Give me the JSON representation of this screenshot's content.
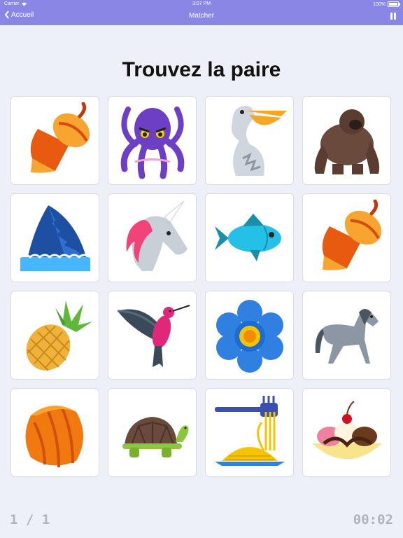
{
  "status_bar": {
    "carrier": "Carrier",
    "time": "3:07 PM",
    "battery": "100%"
  },
  "nav": {
    "back_label": "Accueil",
    "title": "Matcher"
  },
  "heading": "Trouvez la paire",
  "cards": [
    {
      "icon": "acorn-icon"
    },
    {
      "icon": "octopus-icon"
    },
    {
      "icon": "pelican-icon"
    },
    {
      "icon": "gorilla-icon"
    },
    {
      "icon": "shark-fin-icon"
    },
    {
      "icon": "unicorn-icon"
    },
    {
      "icon": "fish-icon"
    },
    {
      "icon": "acorn-icon"
    },
    {
      "icon": "pineapple-icon"
    },
    {
      "icon": "hummingbird-icon"
    },
    {
      "icon": "blue-flower-icon"
    },
    {
      "icon": "horse-icon"
    },
    {
      "icon": "hazelnut-icon"
    },
    {
      "icon": "turtle-icon"
    },
    {
      "icon": "spaghetti-icon"
    },
    {
      "icon": "banana-split-icon"
    }
  ],
  "footer": {
    "progress": "1 / 1",
    "timer": "00:02"
  },
  "colors": {
    "nav_bg": "#8a86e6",
    "page_bg": "#eef0f7",
    "footer_text": "#b0b3ba"
  }
}
